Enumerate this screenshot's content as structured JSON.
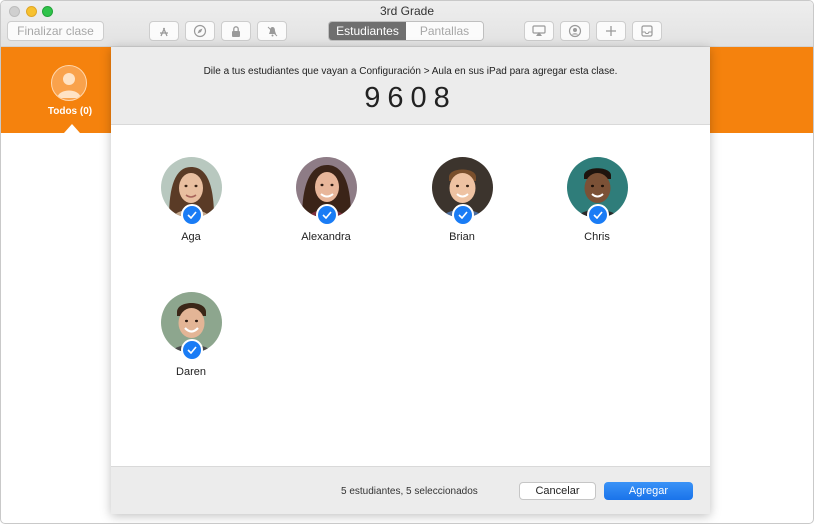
{
  "window": {
    "title": "3rd Grade"
  },
  "toolbar": {
    "end_class_label": "Finalizar clase",
    "icons": [
      "app-store-icon",
      "compass-icon",
      "lock-icon",
      "mute-bell-icon",
      "airplay-icon",
      "screen-view-icon",
      "add-icon",
      "tray-icon"
    ],
    "segments": {
      "students": "Estudiantes",
      "screens": "Pantallas",
      "active": "students"
    }
  },
  "sidebar": {
    "group_label": "Todos (0)"
  },
  "sheet": {
    "instruction": "Dile a tus estudiantes que vayan a Configuración > Aula en sus iPad para agregar esta clase.",
    "code": "9608",
    "students": [
      {
        "name": "Aga",
        "selected": true
      },
      {
        "name": "Alexandra",
        "selected": true
      },
      {
        "name": "Brian",
        "selected": true
      },
      {
        "name": "Chris",
        "selected": true
      },
      {
        "name": "Daren",
        "selected": true
      }
    ],
    "footer": {
      "count_text": "5 estudiantes, 5 seleccionados",
      "cancel_label": "Cancelar",
      "add_label": "Agregar"
    }
  },
  "colors": {
    "accent_orange": "#f5820d",
    "accent_blue": "#1a7cf5"
  }
}
